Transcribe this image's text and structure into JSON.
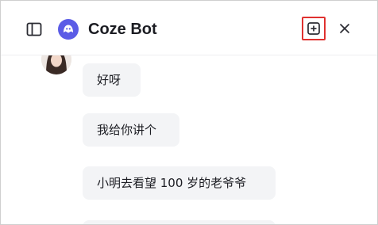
{
  "header": {
    "title": "Coze Bot",
    "sidebar_toggle_icon": "sidebar-panel-icon",
    "new_chat_icon": "plus-square-icon",
    "close_icon": "close-icon",
    "bot_avatar_icon": "coze-logo-icon",
    "accent_color": "#5b5ce6",
    "highlight_color": "#e0312f"
  },
  "chat": {
    "messages": [
      {
        "text": "好呀"
      },
      {
        "text": "我给你讲个"
      },
      {
        "text": "小明去看望 100 岁的老爷爷"
      }
    ]
  }
}
